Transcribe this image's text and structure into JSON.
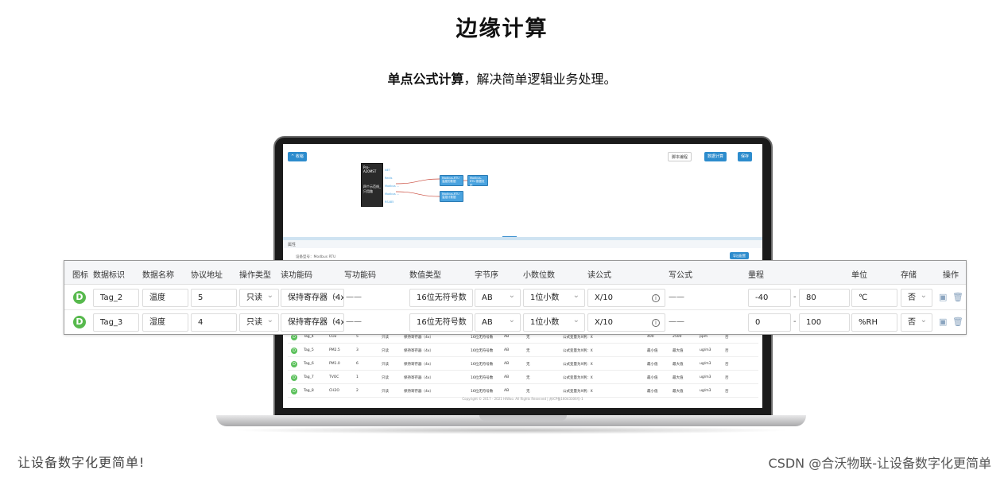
{
  "title": "边缘计算",
  "subtitle": {
    "bold": "单点公式计算",
    "rest": "，解决简单逻辑业务处理。"
  },
  "screen": {
    "collapse_btn": "^ 收缩",
    "script_btn": "脚本编程",
    "sim_btn": "数据计算",
    "save_btn": "保存",
    "device_node": {
      "title": "Pro-A20MST",
      "label": "四个示范线_只用路"
    },
    "ports": [
      "NET",
      "Redis",
      "Modbus ...",
      "Modbus ...",
      "RS485"
    ],
    "blue_nodes": [
      "Modbus-RTU 温度的数据",
      "Modbus-RTU 数据发布",
      "Modbus-RTU 温湿计数据"
    ],
    "props_label": "属性",
    "device_type": "设备型号：Modbus RTU",
    "template_btn": "导出配置",
    "rows": [
      {
        "tag": "Tag_4",
        "name": "CO2",
        "addr": "5",
        "mode": "只读",
        "func": "保持寄存器（4x）",
        "dtype": "16位无符号数",
        "order": "AB",
        "dec": "无",
        "formula": "公式变量为X例：X",
        "min": "400",
        "max": "2500",
        "unit": "ppm",
        "store": "否"
      },
      {
        "tag": "Tag_5",
        "name": "PM2.5",
        "addr": "3",
        "mode": "只读",
        "func": "保持寄存器（4x）",
        "dtype": "16位无符号数",
        "order": "AB",
        "dec": "无",
        "formula": "公式变量为X例：X",
        "min": "最小值",
        "max": "最大值",
        "unit": "ug/m3",
        "store": "否"
      },
      {
        "tag": "Tag_6",
        "name": "PM1.0",
        "addr": "6",
        "mode": "只读",
        "func": "保持寄存器（4x）",
        "dtype": "16位无符号数",
        "order": "AB",
        "dec": "无",
        "formula": "公式变量为X例：X",
        "min": "最小值",
        "max": "最大值",
        "unit": "ug/m3",
        "store": "否"
      },
      {
        "tag": "Tag_7",
        "name": "TVOC",
        "addr": "1",
        "mode": "只读",
        "func": "保持寄存器（4x）",
        "dtype": "16位无符号数",
        "order": "AB",
        "dec": "无",
        "formula": "公式变量为X例：X",
        "min": "最小值",
        "max": "最大值",
        "unit": "ug/m3",
        "store": "否"
      },
      {
        "tag": "Tag_8",
        "name": "CH2O",
        "addr": "2",
        "mode": "只读",
        "func": "保持寄存器（4x）",
        "dtype": "16位无符号数",
        "order": "AB",
        "dec": "无",
        "formula": "公式变量为X例：X",
        "min": "最小值",
        "max": "最大值",
        "unit": "ug/m3",
        "store": "否"
      }
    ],
    "copyright": "Copyright © 2017 - 2021 HiWoo. All Rights Reserved | 苏ICP备16043306号-1"
  },
  "table": {
    "headers": [
      "图标",
      "数据标识",
      "数据名称",
      "协议地址",
      "操作类型",
      "读功能码",
      "写功能码",
      "数值类型",
      "字节序",
      "小数位数",
      "读公式",
      "写公式",
      "量程",
      "单位",
      "存储",
      "操作"
    ],
    "rows": [
      {
        "badge": "D",
        "tag": "Tag_2",
        "name": "温度",
        "addr": "5",
        "mode": "只读",
        "read_func": "保持寄存器（4x）",
        "write_func": "——",
        "dtype": "16位无符号数",
        "order": "AB",
        "dec": "1位小数",
        "read_formula": "X/10",
        "write_formula": "——",
        "min": "-40",
        "sep": "-",
        "max": "80",
        "unit": "℃",
        "store": "否"
      },
      {
        "badge": "D",
        "tag": "Tag_3",
        "name": "湿度",
        "addr": "4",
        "mode": "只读",
        "read_func": "保持寄存器（4x）",
        "write_func": "——",
        "dtype": "16位无符号数",
        "order": "AB",
        "dec": "1位小数",
        "read_formula": "X/10",
        "write_formula": "——",
        "min": "0",
        "sep": "-",
        "max": "100",
        "unit": "%RH",
        "store": "否"
      }
    ]
  },
  "footer_left": "让设备数字化更简单!",
  "footer_right": "CSDN @合沃物联-让设备数字化更简单"
}
